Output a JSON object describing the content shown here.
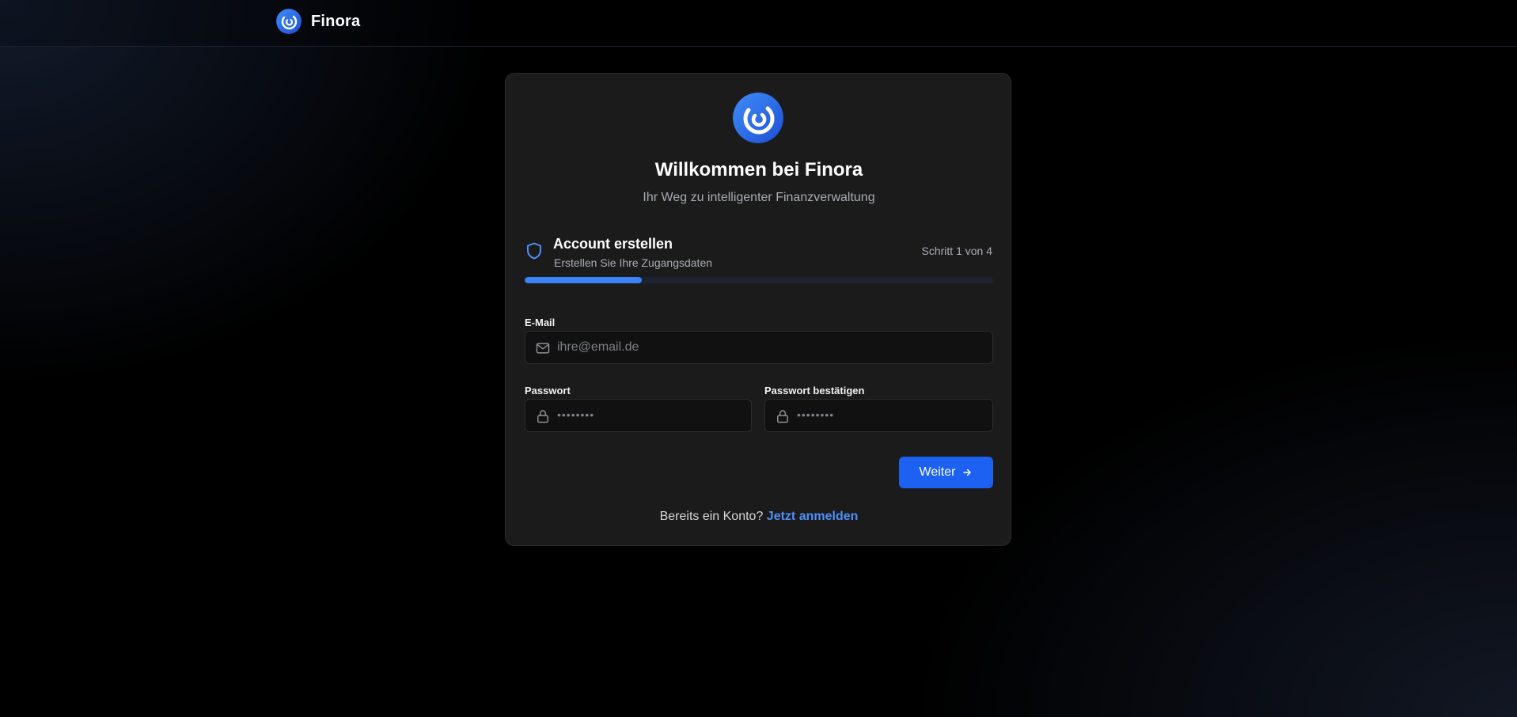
{
  "header": {
    "brand_name": "Finora",
    "logo_icon": "finora-logo-icon"
  },
  "card": {
    "logo_icon": "finora-logo-icon",
    "title": "Willkommen bei Finora",
    "subtitle": "Ihr Weg zu intelligenter Finanzverwaltung"
  },
  "step": {
    "icon": "shield-icon",
    "title": "Account erstellen",
    "description": "Erstellen Sie Ihre Zugangsdaten",
    "counter": "Schritt 1 von 4",
    "progress_fraction": 0.25
  },
  "form": {
    "email": {
      "label": "E-Mail",
      "placeholder": "ihre@email.de",
      "value": "",
      "icon": "mail-icon"
    },
    "password": {
      "label": "Passwort",
      "placeholder": "••••••••",
      "value": "",
      "icon": "lock-icon"
    },
    "password_confirm": {
      "label": "Passwort bestätigen",
      "placeholder": "••••••••",
      "value": "",
      "icon": "lock-icon"
    },
    "submit_label": "Weiter",
    "submit_icon": "arrow-right-icon"
  },
  "footer": {
    "prompt": "Bereits ein Konto?",
    "link_label": "Jetzt anmelden"
  },
  "colors": {
    "accent": "#3b82f6",
    "button": "#1d61f2",
    "link": "#4f8ff7",
    "card_bg": "#1b1b1c"
  }
}
